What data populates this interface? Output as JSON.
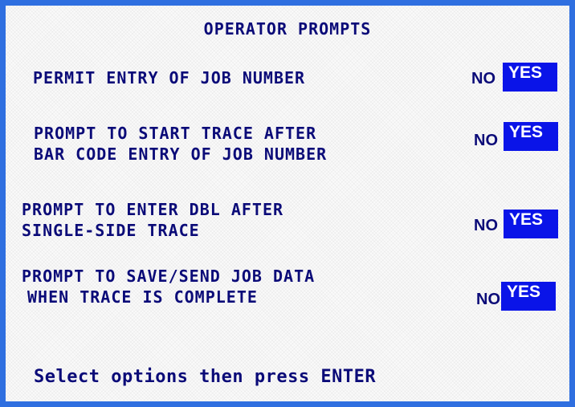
{
  "screen": {
    "title": "OPERATOR PROMPTS",
    "border_color": "#2f6fe0",
    "text_color": "#0b0b78",
    "selection_color": "#0a14e8"
  },
  "prompts": [
    {
      "line1": "PERMIT ENTRY OF JOB NUMBER",
      "line2": "",
      "no_label": "NO",
      "yes_label": "YES",
      "selected": "YES"
    },
    {
      "line1": "PROMPT TO START TRACE AFTER",
      "line2": "BAR CODE ENTRY OF JOB NUMBER",
      "no_label": "NO",
      "yes_label": "YES",
      "selected": "YES"
    },
    {
      "line1": "PROMPT TO ENTER DBL AFTER",
      "line2": "SINGLE-SIDE TRACE",
      "no_label": "NO",
      "yes_label": "YES",
      "selected": "YES"
    },
    {
      "line1": "PROMPT TO SAVE/SEND JOB DATA",
      "line2": "WHEN TRACE IS COMPLETE",
      "no_label": "NO",
      "yes_label": "YES",
      "selected": "YES"
    }
  ],
  "footer": {
    "instruction": "Select options then press ENTER"
  }
}
